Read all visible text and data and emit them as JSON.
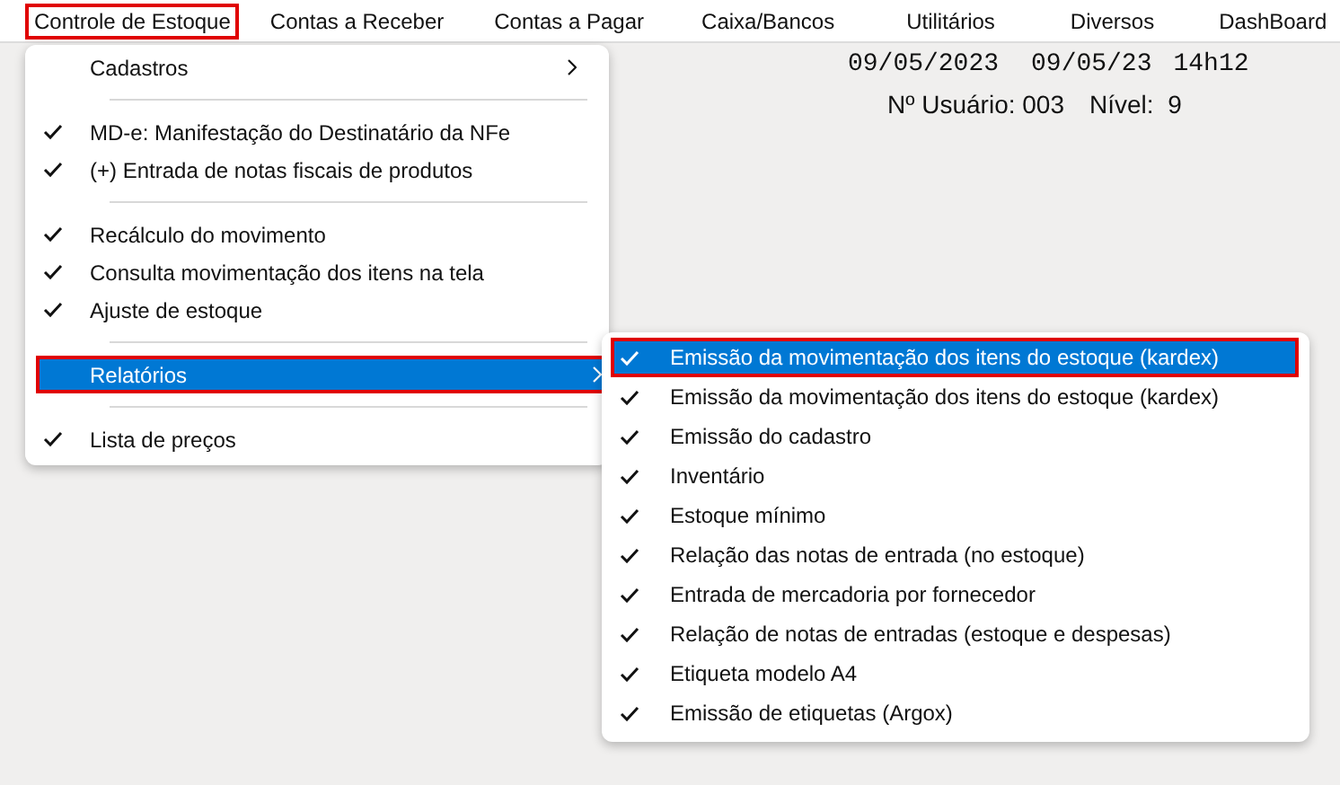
{
  "menubar": [
    {
      "label": "Controle de Estoque",
      "highlighted": true
    },
    {
      "label": "Contas a Receber",
      "highlighted": false
    },
    {
      "label": "Contas a Pagar",
      "highlighted": false
    },
    {
      "label": "Caixa/Bancos",
      "highlighted": false
    },
    {
      "label": "Utilitários",
      "highlighted": false
    },
    {
      "label": "Diversos",
      "highlighted": false
    },
    {
      "label": "DashBoard",
      "highlighted": false
    }
  ],
  "status": {
    "date_long": "09/05/2023",
    "date_short": "09/05/23",
    "time": "14h12",
    "user": "Nº Usuário: 003",
    "level_label": "Nível:  9"
  },
  "menu": [
    {
      "kind": "submenu",
      "label": "Cadastros",
      "checked": false,
      "selected": false,
      "highlighted": false
    },
    {
      "kind": "separator"
    },
    {
      "kind": "item",
      "label": "MD-e: Manifestação do Destinatário da NFe",
      "checked": true,
      "selected": false,
      "highlighted": false
    },
    {
      "kind": "item",
      "label": "(+) Entrada de notas fiscais de produtos",
      "checked": true,
      "selected": false,
      "highlighted": false
    },
    {
      "kind": "separator"
    },
    {
      "kind": "item",
      "label": "Recálculo do movimento",
      "checked": true,
      "selected": false,
      "highlighted": false
    },
    {
      "kind": "item",
      "label": "Consulta movimentação dos itens na tela",
      "checked": true,
      "selected": false,
      "highlighted": false
    },
    {
      "kind": "item",
      "label": "Ajuste de estoque",
      "checked": true,
      "selected": false,
      "highlighted": false
    },
    {
      "kind": "separator"
    },
    {
      "kind": "submenu",
      "label": "Relatórios",
      "checked": false,
      "selected": true,
      "highlighted": true
    },
    {
      "kind": "separator"
    },
    {
      "kind": "item",
      "label": "Lista de preços",
      "checked": true,
      "selected": false,
      "highlighted": false
    }
  ],
  "submenu": [
    {
      "label": "Emissão da movimentação dos itens do estoque (kardex)",
      "checked": true,
      "selected": true,
      "highlighted": true
    },
    {
      "label": "Emissão da movimentação dos itens do estoque (kardex)",
      "checked": true,
      "selected": false,
      "highlighted": false
    },
    {
      "label": "Emissão do cadastro",
      "checked": true,
      "selected": false,
      "highlighted": false
    },
    {
      "label": "Inventário",
      "checked": true,
      "selected": false,
      "highlighted": false
    },
    {
      "label": "Estoque mínimo",
      "checked": true,
      "selected": false,
      "highlighted": false
    },
    {
      "label": "Relação das notas de entrada (no estoque)",
      "checked": true,
      "selected": false,
      "highlighted": false
    },
    {
      "label": "Entrada de mercadoria por fornecedor",
      "checked": true,
      "selected": false,
      "highlighted": false
    },
    {
      "label": "Relação de notas de entradas (estoque e despesas)",
      "checked": true,
      "selected": false,
      "highlighted": false
    },
    {
      "label": "Etiqueta modelo A4",
      "checked": true,
      "selected": false,
      "highlighted": false
    },
    {
      "label": "Emissão de etiquetas (Argox)",
      "checked": true,
      "selected": false,
      "highlighted": false
    }
  ]
}
